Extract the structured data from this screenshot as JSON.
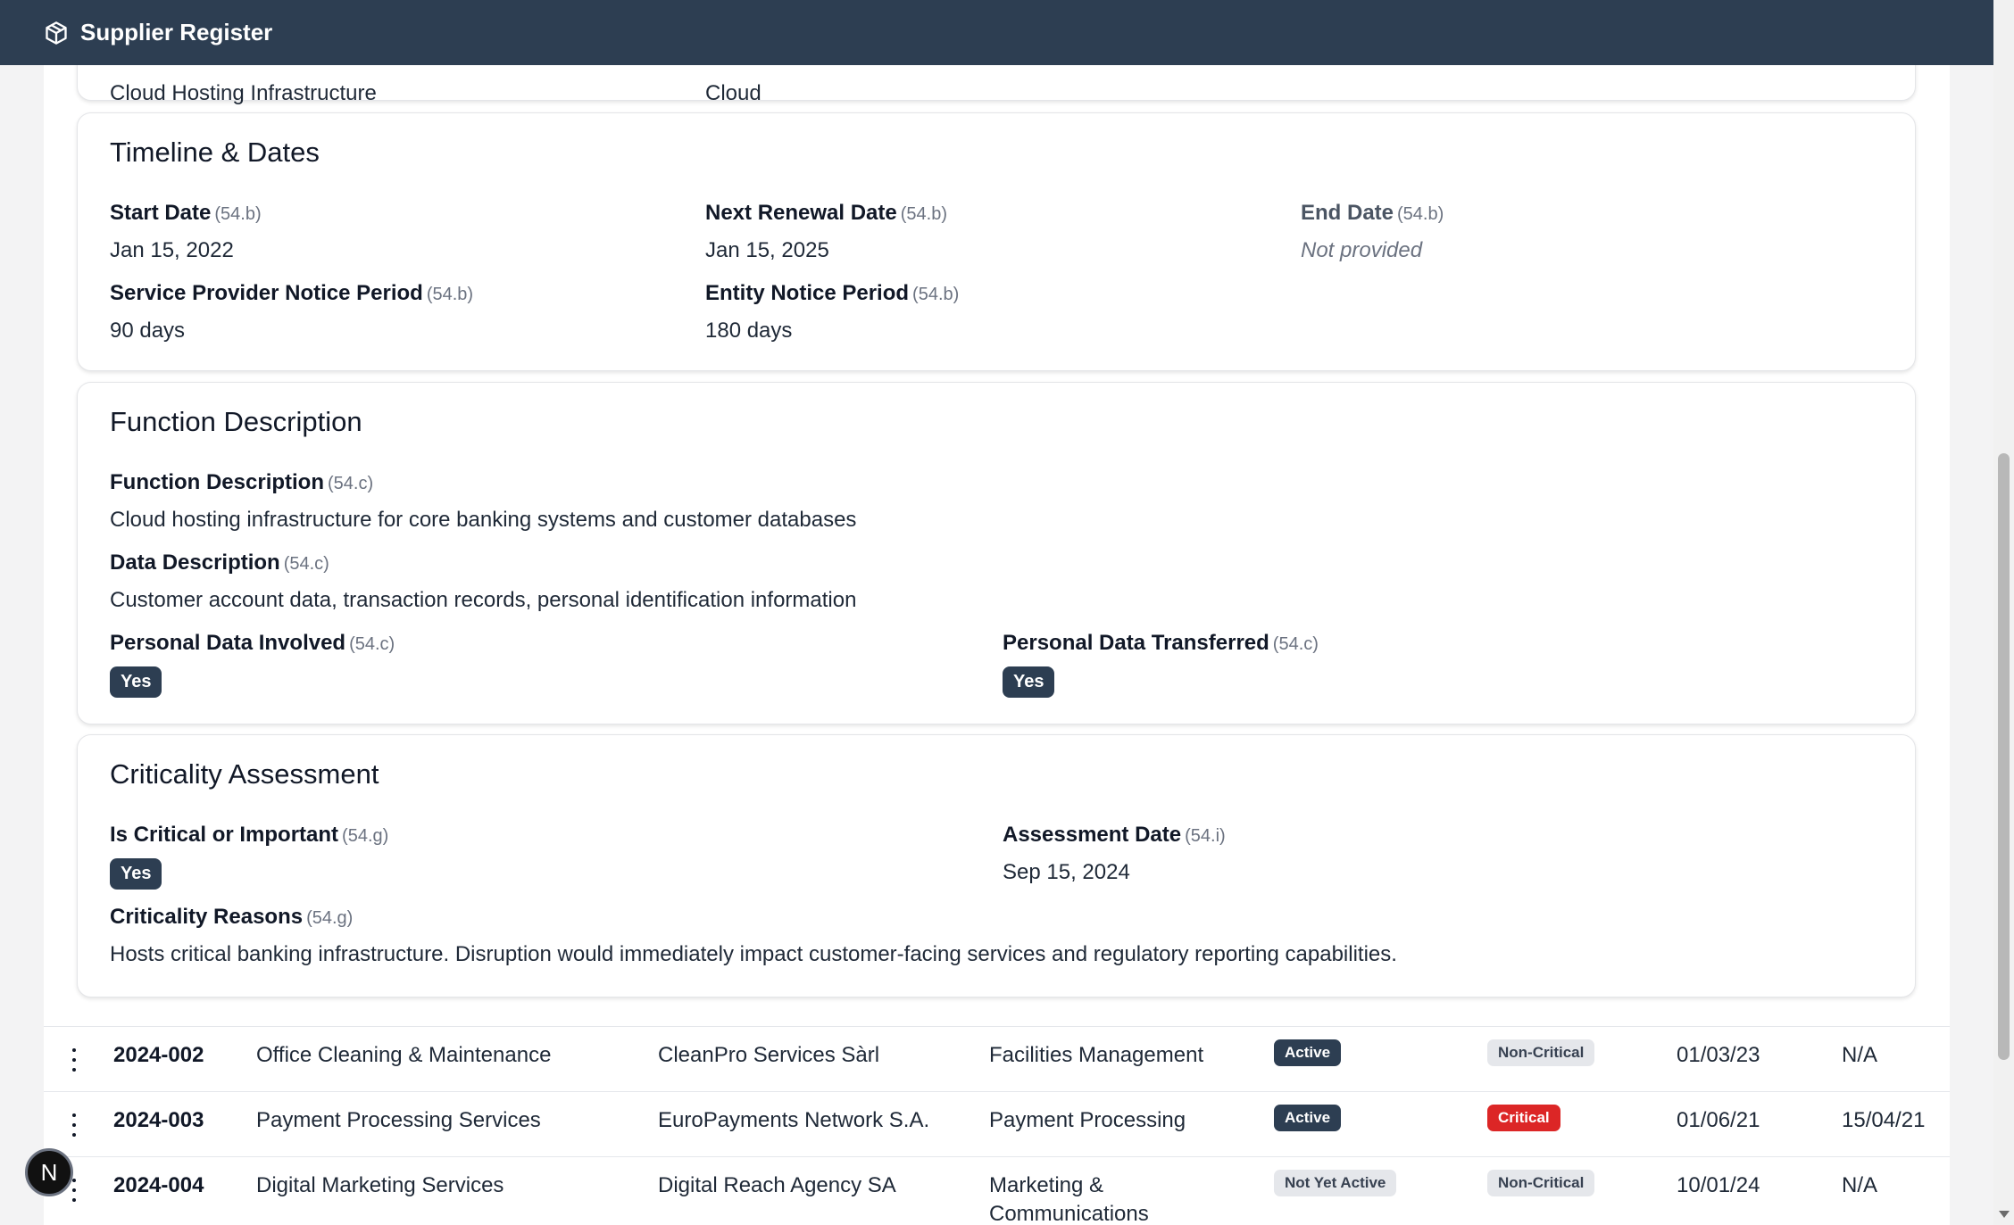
{
  "app": {
    "title": "Supplier Register",
    "logo_icon": "cube-icon"
  },
  "prev_card": {
    "col1_value": "Cloud Hosting Infrastructure",
    "col2_value": "Cloud"
  },
  "timeline": {
    "title": "Timeline & Dates",
    "start_date": {
      "label": "Start Date",
      "ref": "(54.b)",
      "value": "Jan 15, 2022"
    },
    "next_renewal": {
      "label": "Next Renewal Date",
      "ref": "(54.b)",
      "value": "Jan 15, 2025"
    },
    "end_date": {
      "label": "End Date",
      "ref": "(54.b)",
      "value": "Not provided"
    },
    "provider_notice": {
      "label": "Service Provider Notice Period",
      "ref": "(54.b)",
      "value": "90 days"
    },
    "entity_notice": {
      "label": "Entity Notice Period",
      "ref": "(54.b)",
      "value": "180 days"
    }
  },
  "function": {
    "title": "Function Description",
    "function_desc": {
      "label": "Function Description",
      "ref": "(54.c)",
      "value": "Cloud hosting infrastructure for core banking systems and customer databases"
    },
    "data_desc": {
      "label": "Data Description",
      "ref": "(54.c)",
      "value": "Customer account data, transaction records, personal identification information"
    },
    "personal_involved": {
      "label": "Personal Data Involved",
      "ref": "(54.c)",
      "value": "Yes"
    },
    "personal_transferred": {
      "label": "Personal Data Transferred",
      "ref": "(54.c)",
      "value": "Yes"
    }
  },
  "criticality": {
    "title": "Criticality Assessment",
    "is_critical": {
      "label": "Is Critical or Important",
      "ref": "(54.g)",
      "value": "Yes"
    },
    "assessment_date": {
      "label": "Assessment Date",
      "ref": "(54.i)",
      "value": "Sep 15, 2024"
    },
    "reasons": {
      "label": "Criticality Reasons",
      "ref": "(54.g)",
      "value": "Hosts critical banking infrastructure. Disruption would immediately impact customer-facing services and regulatory reporting capabilities."
    }
  },
  "rows": [
    {
      "id": "2024-002",
      "service": "Office Cleaning & Maintenance",
      "provider": "CleanPro Services Sàrl",
      "category": "Facilities Management",
      "category2": "",
      "status": "Active",
      "criticality": "Non-Critical",
      "start": "01/03/23",
      "end": "N/A"
    },
    {
      "id": "2024-003",
      "service": "Payment Processing Services",
      "provider": "EuroPayments Network S.A.",
      "category": "Payment Processing",
      "category2": "",
      "status": "Active",
      "criticality": "Critical",
      "start": "01/06/21",
      "end": "15/04/21"
    },
    {
      "id": "2024-004",
      "service": "Digital Marketing Services",
      "provider": "Digital Reach Agency SA",
      "category": "Marketing &",
      "category2": "Communications",
      "status": "Not Yet Active",
      "criticality": "Non-Critical",
      "start": "10/01/24",
      "end": "N/A"
    }
  ],
  "fab": {
    "label": "N"
  }
}
